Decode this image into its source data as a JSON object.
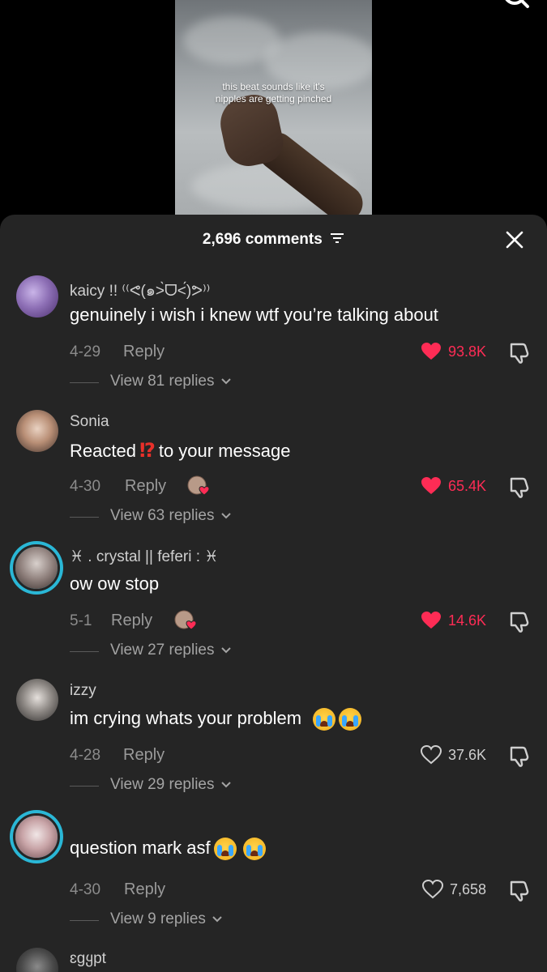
{
  "video": {
    "caption_line1": "this beat sounds like it's",
    "caption_line2": "nipples are getting pinched"
  },
  "header": {
    "comment_count": "2,696 comments"
  },
  "colors": {
    "sheet_bg": "#252525",
    "liked_red": "#fe2c55",
    "ring_blue": "#2ab7d6"
  },
  "comments": [
    {
      "username": "kaicy !! ⁽⁽ᕙ(๑˃̀ᗜ˂́)ᕗ⁾⁾",
      "text": "genuinely i wish i knew wtf you’re talking about",
      "date": "4-29",
      "reply": "Reply",
      "likes": "93.8K",
      "liked": true,
      "view_replies": "View 81 replies"
    },
    {
      "username": "Sonia",
      "text_before": "Reacted",
      "text_emoji": "⁉",
      "text_after": "to your message",
      "date": "4-30",
      "reply": "Reply",
      "likes": "65.4K",
      "liked": true,
      "view_replies": "View 63 replies"
    },
    {
      "username": "♓ . crystal || feferi : ♓",
      "text": "ow ow stop",
      "date": "5-1",
      "reply": "Reply",
      "likes": "14.6K",
      "liked": true,
      "view_replies": "View 27 replies"
    },
    {
      "username": "izzy",
      "text": "im crying whats your problem",
      "date": "4-28",
      "reply": "Reply",
      "likes": "37.6K",
      "liked": false,
      "view_replies": "View 29 replies"
    },
    {
      "username": "",
      "text": "question mark asf",
      "date": "4-30",
      "reply": "Reply",
      "likes": "7,658",
      "liked": false,
      "view_replies": "View 9 replies"
    },
    {
      "username": "ɛgყpt"
    }
  ]
}
